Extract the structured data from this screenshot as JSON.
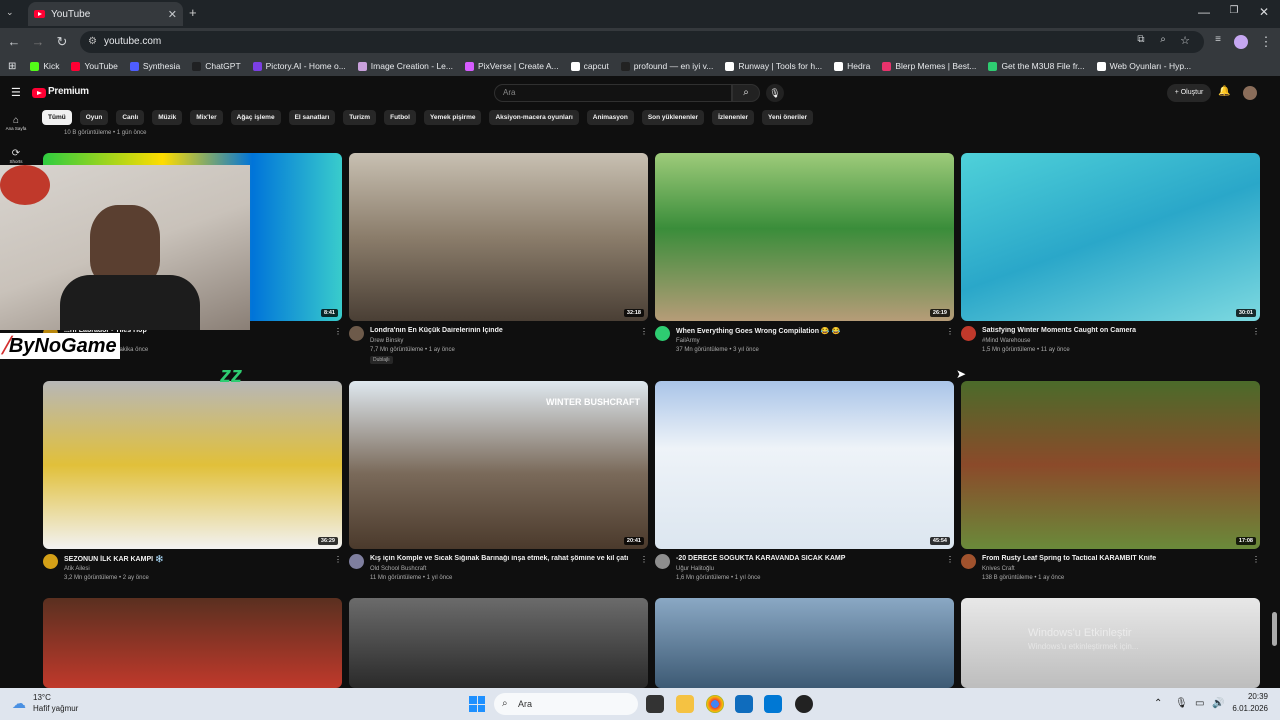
{
  "browser": {
    "tab_title": "YouTube",
    "url": "youtube.com",
    "bookmarks": [
      {
        "label": "Kick",
        "color": "#53fc18"
      },
      {
        "label": "YouTube",
        "color": "#ff0033"
      },
      {
        "label": "Synthesia",
        "color": "#4e5dff"
      },
      {
        "label": "ChatGPT",
        "color": "#202123"
      },
      {
        "label": "Pictory.AI - Home o...",
        "color": "#7b3fe4"
      },
      {
        "label": "Image Creation - Le...",
        "color": "#c9a0dc"
      },
      {
        "label": "PixVerse | Create A...",
        "color": "#d65cff"
      },
      {
        "label": "capcut",
        "color": "#ffffff"
      },
      {
        "label": "profound — en iyi v...",
        "color": "#222222"
      },
      {
        "label": "Runway | Tools for h...",
        "color": "#ffffff"
      },
      {
        "label": "Hedra",
        "color": "#ffffff"
      },
      {
        "label": "Blerp Memes | Best...",
        "color": "#e8336c"
      },
      {
        "label": "Get the M3U8 File fr...",
        "color": "#2ecc71"
      },
      {
        "label": "Web Oyunları - Hyp...",
        "color": "#ffffff"
      }
    ]
  },
  "youtube": {
    "logo": "Premium",
    "search_placeholder": "Ara",
    "create_label": "Oluştur",
    "rail": [
      {
        "label": "Ana Sayfa"
      },
      {
        "label": "Shorts"
      }
    ],
    "chips": [
      "Tümü",
      "Oyun",
      "Canlı",
      "Müzik",
      "Mix'ler",
      "Ağaç işleme",
      "El sanatları",
      "Turizm",
      "Futbol",
      "Yemek pişirme",
      "Aksiyon-macera oyunları",
      "Animasyon",
      "Son yüklenenler",
      "İzlenenler",
      "Yeni öneriler"
    ],
    "top_meta": "10 B görüntüleme • 1 gün önce",
    "overlay_brand": "ByNoGame",
    "videos": [
      {
        "title": "...rif Labrador - Tiles Hop",
        "channel": "",
        "meta": "3 görüntüleme • 19 dakika önce",
        "duration": "8:41",
        "avatar_color": "#b8860b"
      },
      {
        "title": "Londra'nın En Küçük Dairelerinin İçinde",
        "channel": "Drew Binsky",
        "meta": "7,7 Mn görüntüleme • 1 ay önce",
        "duration": "32:18",
        "avatar_color": "#6d5a4a",
        "tag": "Dublajlı"
      },
      {
        "title": "When Everything Goes Wrong Compilation 😂 😂",
        "channel": "FailArmy",
        "meta": "37 Mn görüntüleme • 3 yıl önce",
        "duration": "26:19",
        "avatar_color": "#2ecc71"
      },
      {
        "title": "Satisfying Winter Moments Caught on Camera",
        "channel": "#Mind Warehouse",
        "meta": "1,5 Mn görüntüleme • 11 ay önce",
        "duration": "30:01",
        "avatar_color": "#c0392b"
      },
      {
        "title": "SEZONUN İLK KAR KAMPI ❄️",
        "channel": "Atik Ailesi",
        "meta": "3,2 Mn görüntüleme • 2 ay önce",
        "duration": "36:29",
        "avatar_color": "#d4a017"
      },
      {
        "title": "Kış için Komple ve Sıcak Sığınak Barınağı inşa etmek, rahat şömine ve kil çatı",
        "channel": "Old School Bushcraft",
        "meta": "11 Mn görüntüleme • 1 yıl önce",
        "duration": "20:41",
        "avatar_color": "#7f7f9f"
      },
      {
        "title": "-20 DERECE SOĞUKTA KARAVANDA SICAK KAMP",
        "channel": "Uğur Halitoğlu",
        "meta": "1,6 Mn görüntüleme • 1 yıl önce",
        "duration": "45:54",
        "avatar_color": "#8e8e8e"
      },
      {
        "title": "From Rusty Leaf Spring to Tactical KARAMBIT Knife",
        "channel": "Knives Craft",
        "meta": "138 B görüntüleme • 1 ay önce",
        "duration": "17:08",
        "avatar_color": "#a0522d"
      }
    ],
    "thumb_overlay_text": "WINTER BUSHCRAFT",
    "watermark": "Windows'u Etkinleştir",
    "watermark_sub": "Windows'u etkinleştirmek için..."
  },
  "taskbar": {
    "weather_temp": "13°C",
    "weather_desc": "Hafif yağmur",
    "search_label": "Ara",
    "time": "20:39",
    "date": "6.01.2026"
  },
  "colors": {
    "accent": "#ff0033",
    "bg": "#0f0f0f"
  }
}
